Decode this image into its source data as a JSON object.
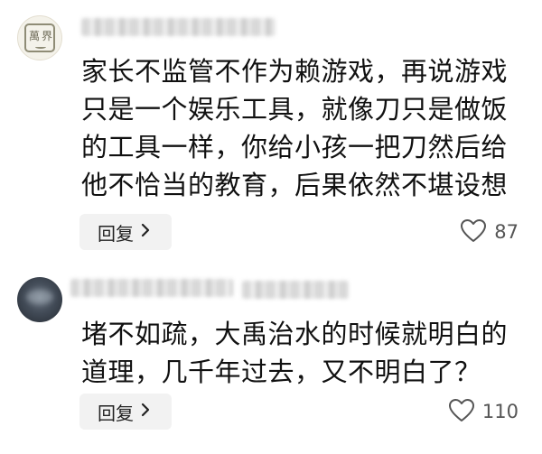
{
  "comments": [
    {
      "avatar_text": [
        "萬",
        "界"
      ],
      "lines": [
        "家长不监管不作为赖游戏，再说游戏",
        "只是一个娱乐工具，就像刀只是做饭",
        "的工具一样，你给小孩一把刀然后给",
        "他不恰当的教育，后果依然不堪设想"
      ],
      "reply_label": "回复",
      "likes": "87"
    },
    {
      "lines": [
        "堵不如疏，大禹治水的时候就明白的",
        "道理，几千年过去，又不明白了？"
      ],
      "reply_label": "回复",
      "likes": "110"
    }
  ],
  "icons": {
    "reply_chevron": "chevron-right-icon",
    "like": "heart-outline-icon"
  },
  "colors": {
    "text": "#111111",
    "button_bg": "#f2f2f2",
    "like_count": "#555555"
  }
}
